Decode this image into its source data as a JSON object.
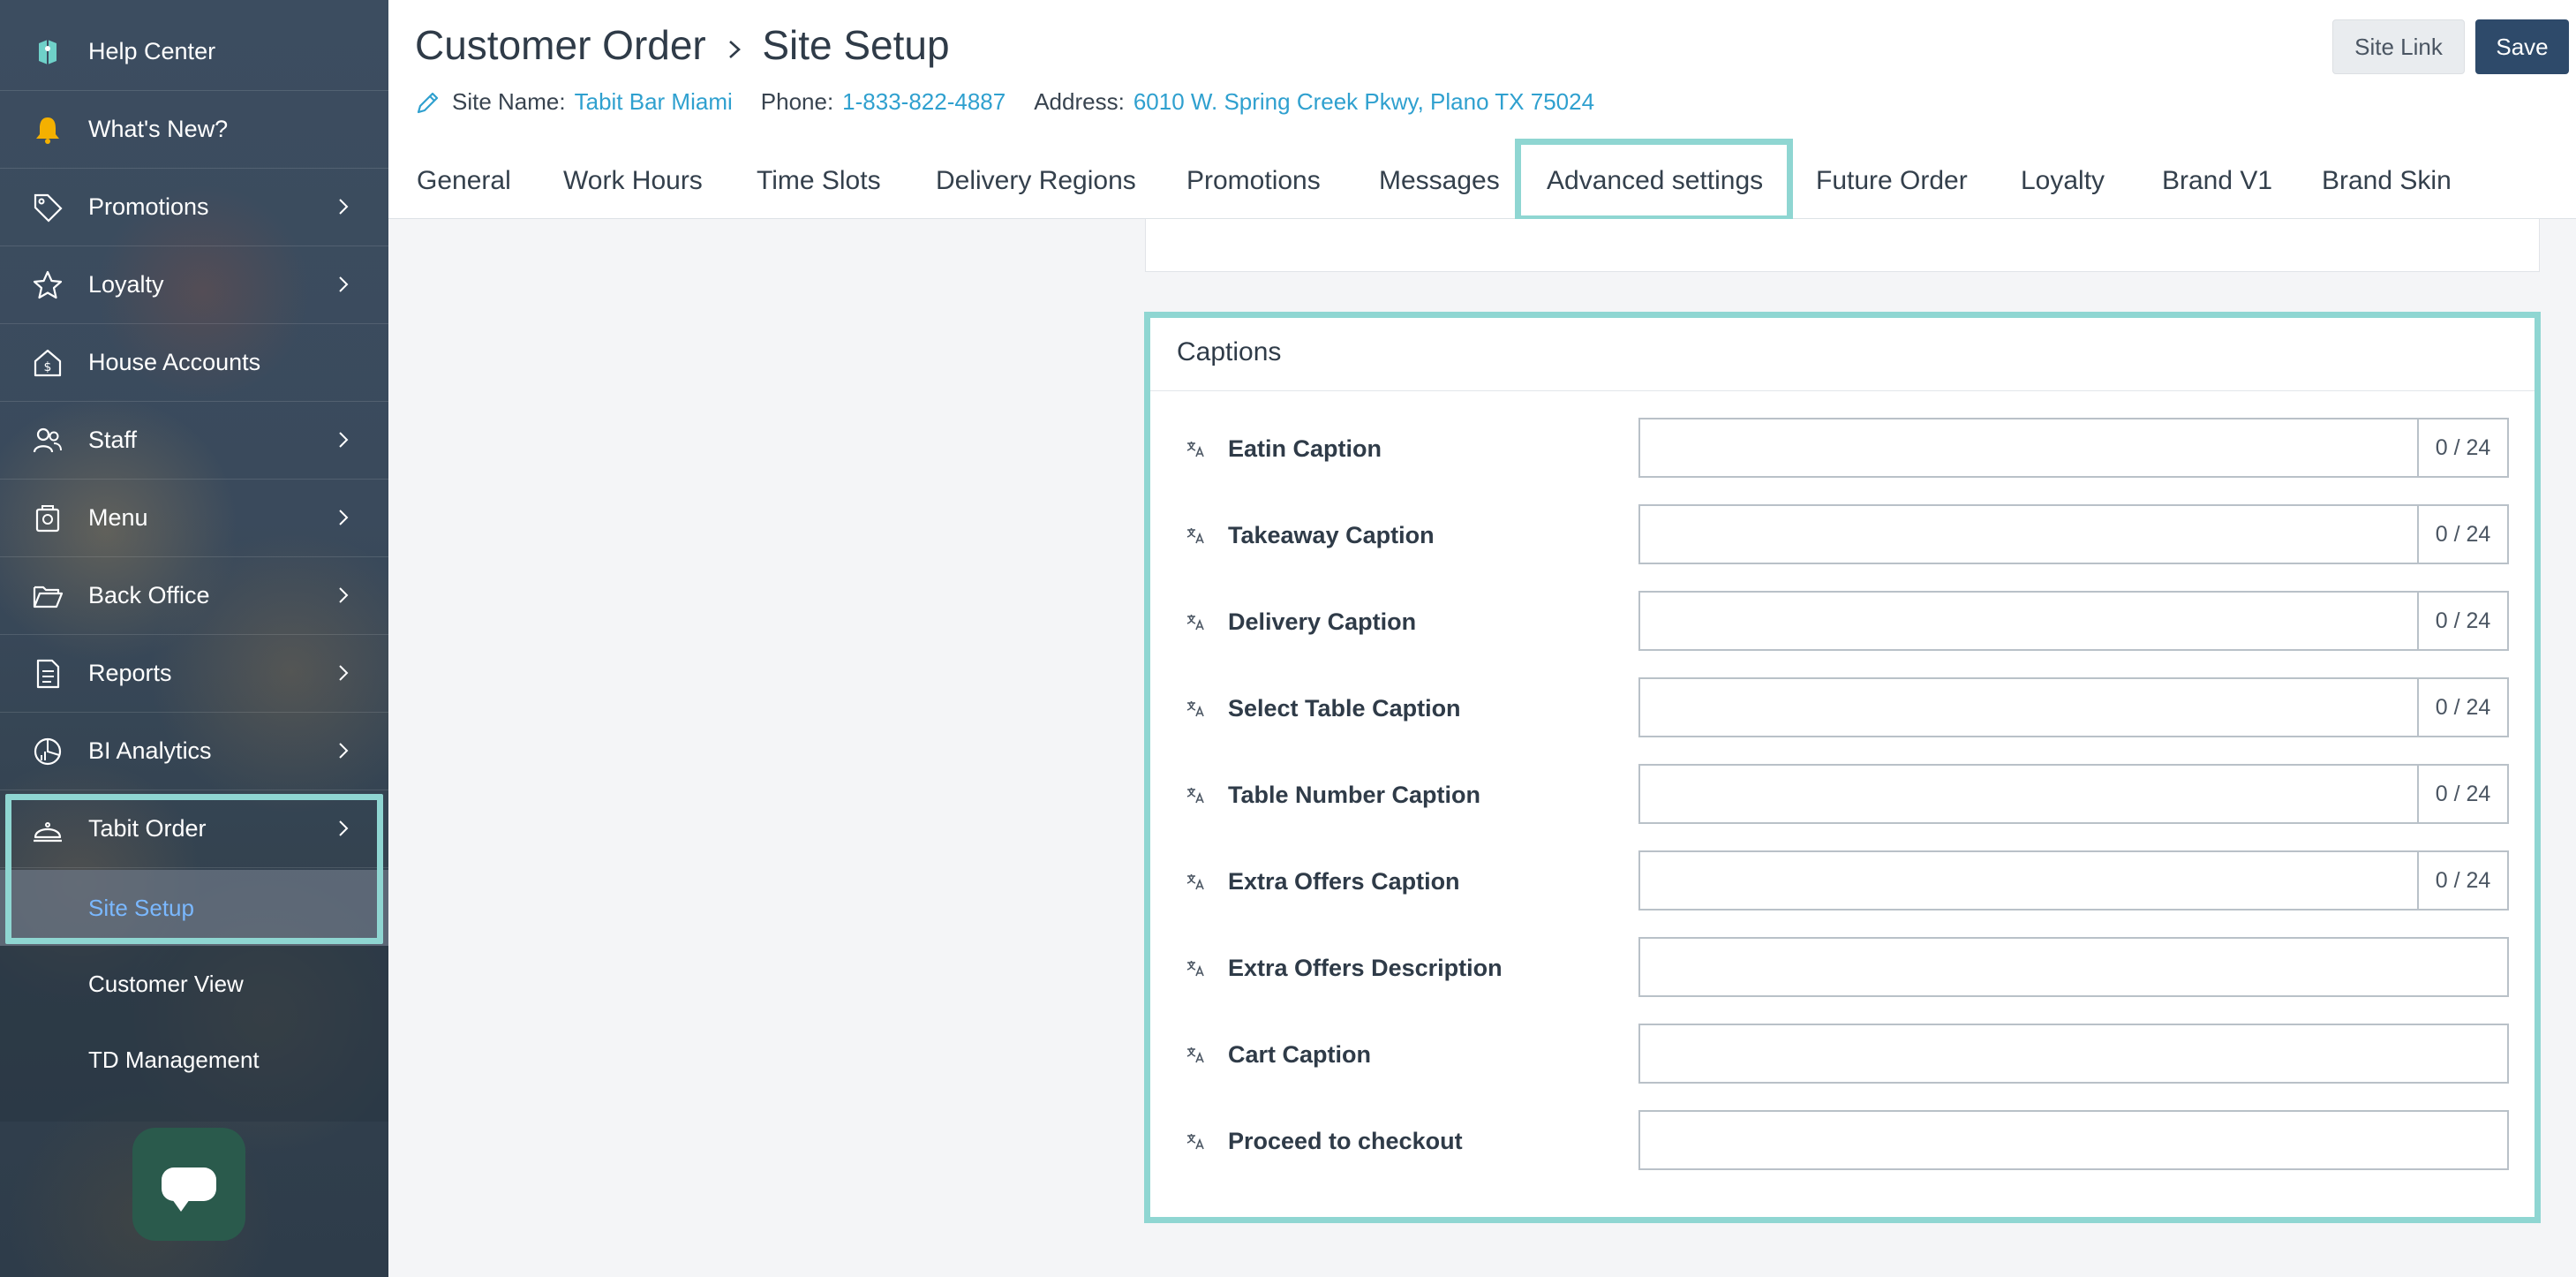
{
  "sidebar": {
    "items": [
      {
        "label": "Help Center",
        "icon": "help-center-icon"
      },
      {
        "label": "What's New?",
        "icon": "bell-icon"
      },
      {
        "label": "Promotions",
        "icon": "tag-icon"
      },
      {
        "label": "Loyalty",
        "icon": "star-icon"
      },
      {
        "label": "House Accounts",
        "icon": "house-dollar-icon"
      },
      {
        "label": "Staff",
        "icon": "people-icon"
      },
      {
        "label": "Menu",
        "icon": "menu-book-icon"
      },
      {
        "label": "Back Office",
        "icon": "folder-open-icon"
      },
      {
        "label": "Reports",
        "icon": "document-icon"
      },
      {
        "label": "BI Analytics",
        "icon": "pie-chart-icon"
      },
      {
        "label": "Tabit Order",
        "icon": "cloche-icon"
      }
    ],
    "subitems": [
      {
        "label": "Site Setup"
      },
      {
        "label": "Customer View"
      },
      {
        "label": "TD Management"
      }
    ]
  },
  "header": {
    "title_part1": "Customer Order",
    "title_part2": "Site Setup",
    "site_name_label": "Site Name:",
    "site_name": "Tabit Bar Miami",
    "phone_label": "Phone:",
    "phone": "1-833-822-4887",
    "address_label": "Address:",
    "address": "6010 W. Spring Creek Pkwy, Plano TX 75024",
    "site_link_label": "Site Link",
    "save_label": "Save"
  },
  "tabs": [
    "General",
    "Work Hours",
    "Time Slots",
    "Delivery Regions",
    "Promotions",
    "Messages",
    "Advanced settings",
    "Future Order",
    "Loyalty",
    "Brand V1",
    "Brand Skin"
  ],
  "captions": {
    "title": "Captions",
    "rows": [
      {
        "label": "Eatin Caption",
        "value": "",
        "counter": "0 / 24"
      },
      {
        "label": "Takeaway Caption",
        "value": "",
        "counter": "0 / 24"
      },
      {
        "label": "Delivery Caption",
        "value": "",
        "counter": "0 / 24"
      },
      {
        "label": "Select Table Caption",
        "value": "",
        "counter": "0 / 24"
      },
      {
        "label": "Table Number Caption",
        "value": "",
        "counter": "0 / 24"
      },
      {
        "label": "Extra Offers Caption",
        "value": "",
        "counter": "0 / 24"
      },
      {
        "label": "Extra Offers Description",
        "value": ""
      },
      {
        "label": "Cart Caption",
        "value": ""
      },
      {
        "label": "Proceed to checkout",
        "value": ""
      }
    ]
  },
  "colors": {
    "accent": "#2fa0cf",
    "highlight": "#8fd6d2",
    "save_button": "#2e4a6a"
  }
}
